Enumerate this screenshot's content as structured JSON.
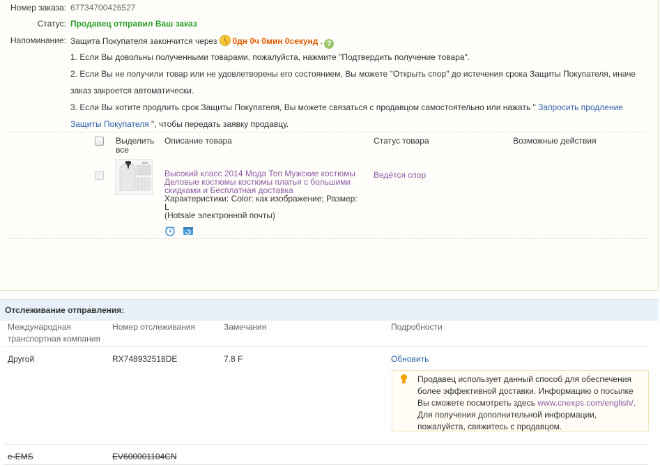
{
  "order": {
    "number_label": "Номер заказа:",
    "number_value": "67734700426527",
    "status_label": "Статус:",
    "status_value": "Продавец отправил Ваш заказ",
    "reminder_label": "Напоминание:",
    "reminder_text": "Защита Покупателя закончится через",
    "countdown": "0дн 0ч 0мин 0секунд",
    "countdown_suffix": ".",
    "note_1": "1. Если Вы довольны полученными товарами, пожалуйста, нажмите \"Подтвердить получение товара\".",
    "note_2a": "2. Если Вы не получили товар или не удовлетворены его состоянием, Вы можете \"Открыть спор\" до истечения срока Защиты Покупателя, иначе",
    "note_2b": "заказ закроется автоматически.",
    "note_3a": "3. Если Вы хотите продлить срок Защиты Покупателя, Вы можете связаться с продавцом самостоятельно или нажать \" ",
    "note_3_link_a": "Запросить продление",
    "note_3_link_b": "Защиты Покупателя",
    "note_3b": " \", чтобы передать заявку продавцу."
  },
  "products_table": {
    "col_select": "Выделить все",
    "col_select_line1": "Выделить",
    "col_select_line2": "все",
    "col_description": "Описание товара",
    "col_status": "Статус товара",
    "col_actions": "Возможные действия",
    "rows": [
      {
        "title_1": "Высокий класс 2014 Мода Топ Мужские костюмы",
        "title_2": "Деловые костюмы костюмы платья с большими",
        "title_3": "скидками и Бесплатная доставка",
        "specs_1": "Характеристики: Color: как изображение; Размер:",
        "specs_2": "L",
        "specs_3": "(Hotsale электронной почты)",
        "status": "Ведётся спор",
        "thumb_brand": "BOS"
      }
    ]
  },
  "tracking": {
    "header": "Отслеживание отправления:",
    "col_carrier_1": "Международная",
    "col_carrier_2": "транспортная компания",
    "col_number": "Номер отслеживания",
    "col_remarks": "Замечания",
    "col_details": "Подробности",
    "rows": [
      {
        "carrier": "Другой",
        "number": "RX748932518DE",
        "remarks": "7.8 F",
        "details_link": "Обновить",
        "info_1": "Продавец использует данный способ для обеспечения",
        "info_2": "более эффективной доставки. Информацию о посылке",
        "info_3": "Вы сможете посмотреть здесь ",
        "info_3_link": "www.cnexps.com/english/",
        "info_3_end": ".",
        "info_4": "Для получения дополнительной информации,",
        "info_5": "пожалуйста, свяжитесь с продавцом."
      },
      {
        "carrier": "e-EMS",
        "number": "EV600001104CN"
      }
    ]
  },
  "colors": {
    "status_green": "#2a9e2a",
    "countdown_orange": "#e05a00",
    "link_blue": "#2a5ea8",
    "product_purple": "#8d5aa5",
    "tracking_header_bg": "#e8f1f9"
  }
}
